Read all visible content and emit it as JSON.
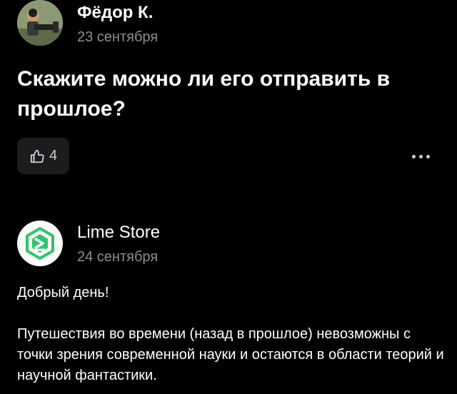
{
  "question": {
    "author_name": "Фёдор К.",
    "date": "23 сентября",
    "text": "Скажите можно ли его отправить в прошлое?",
    "likes_count": "4",
    "like_icon": "thumbs-up-icon",
    "more_icon": "more-horizontal-icon"
  },
  "answer": {
    "author_name": "Lime Store",
    "date": "24 сентября",
    "logo_icon": "lime-store-logo-icon",
    "paragraphs": [
      "Добрый день!",
      "Путешествия во времени (назад в прошлое) невозможны с точки зрения современной науки и остаются в области теорий и научной фантастики."
    ]
  },
  "colors": {
    "background": "#000000",
    "text_primary": "#ffffff",
    "text_secondary": "#8e8e93",
    "button_bg": "#1c1c1e",
    "brand_green": "#2fc46a"
  }
}
